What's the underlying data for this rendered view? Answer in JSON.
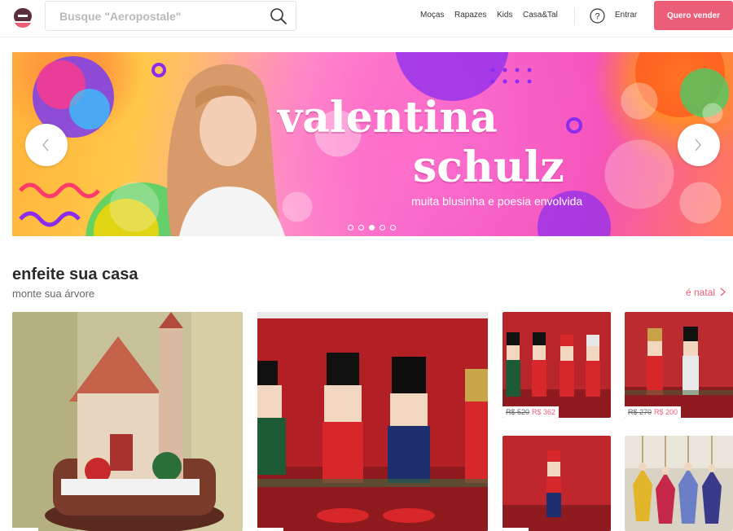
{
  "header": {
    "search_placeholder": "Busque \"Aeropostale\"",
    "nav": [
      "Moças",
      "Rapazes",
      "Kids",
      "Casa&Tal"
    ],
    "login_label": "Entrar",
    "sell_label": "Quero vender",
    "accent_color": "#ec5d78"
  },
  "hero": {
    "title_line1": "valentina",
    "title_line2": "schulz",
    "subtitle": "muita blusinha e poesia envolvida",
    "slide_count": 5,
    "active_slide": 3
  },
  "section": {
    "title": "enfeite sua casa",
    "subtitle": "monte sua árvore",
    "link_label": "é natal"
  },
  "products": [
    {
      "name": "christmas-house",
      "old_price": "",
      "price": ""
    },
    {
      "name": "nutcracker-trio",
      "old_price": "",
      "price": ""
    },
    {
      "name": "nutcracker-set-4",
      "old_price": "R$ 520",
      "price": "R$ 362"
    },
    {
      "name": "nutcracker-set-2",
      "old_price": "R$ 270",
      "price": "R$ 200"
    },
    {
      "name": "nutcracker-single",
      "old_price": "",
      "price": ""
    },
    {
      "name": "princess-ornaments",
      "old_price": "",
      "price": ""
    }
  ]
}
